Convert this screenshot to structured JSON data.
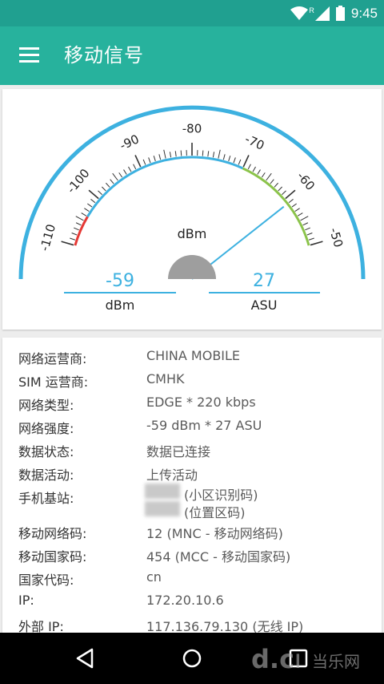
{
  "status_bar": {
    "time": "9:45",
    "roaming_label": "R",
    "icons": [
      "wifi-icon",
      "signal-icon",
      "battery-icon"
    ]
  },
  "app_bar": {
    "title": "移动信号",
    "menu_icon": "menu-icon"
  },
  "gauge": {
    "unit_label": "dBm",
    "scale_labels": [
      "-110",
      "-100",
      "-90",
      "-80",
      "-70",
      "-60",
      "-50"
    ],
    "needle_value": -59,
    "dbm_value": "-59",
    "dbm_caption": "dBm",
    "asu_value": "27",
    "asu_caption": "ASU",
    "colors": {
      "outer_arc": "#3db1e0",
      "low_segment": "#e53935",
      "mid_segment": "#3db1e0",
      "high_segment": "#8bc34a",
      "value_text": "#3db1e0",
      "hub": "#9e9e9e"
    }
  },
  "info": {
    "rows": [
      {
        "label": "网络运营商:",
        "value": "CHINA MOBILE"
      },
      {
        "label": "SIM 运营商:",
        "value": "CMHK"
      },
      {
        "label": "网络类型:",
        "value": "EDGE * 220 kbps"
      },
      {
        "label": "网络强度:",
        "value": "-59 dBm * 27 ASU"
      },
      {
        "label": "数据状态:",
        "value": "数据已连接"
      },
      {
        "label": "数据活动:",
        "value": "上传活动"
      },
      {
        "label": "手机基站:",
        "value": "(小区识别码)",
        "value2": "(位置区码)"
      },
      {
        "label": "移动网络码:",
        "value": "12 (MNC - 移动网络码)"
      },
      {
        "label": "移动国家码:",
        "value": "454 (MCC - 移动国家码)"
      },
      {
        "label": "国家代码:",
        "value": "cn"
      },
      {
        "label": "IP:",
        "value": "172.20.10.6"
      },
      {
        "label": "外部 IP:",
        "value": "117.136.79.130 (无线 IP)"
      }
    ]
  },
  "nav_bar": {
    "buttons": [
      "back-icon",
      "home-icon",
      "recents-icon"
    ],
    "watermark": "当乐网"
  }
}
